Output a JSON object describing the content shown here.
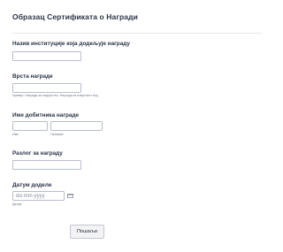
{
  "form": {
    "title": "Образац Сертификата о Награди",
    "fields": {
      "institution": {
        "label": "Назив институције која додељује награду",
        "value": ""
      },
      "award_type": {
        "label": "Врста награде",
        "value": "",
        "hint": "пример: Награда за лидерство, Награда за изврсност итд."
      },
      "recipient": {
        "label": "Име добитника награде",
        "first_value": "",
        "last_value": "",
        "first_sublabel": "Име",
        "last_sublabel": "Презиме"
      },
      "reason": {
        "label": "Разлог за награду",
        "value": ""
      },
      "date": {
        "label": "Датум доделе",
        "placeholder": "dd-mm-yyyy",
        "value": "",
        "sublabel": "Датум",
        "icon": "calendar-icon"
      }
    },
    "submit_label": "Пошаљи"
  },
  "colors": {
    "text": "#2c3345",
    "input_border": "#b8bdc9",
    "divider": "#e6e8ee",
    "button_bg": "#f3f3f5"
  }
}
